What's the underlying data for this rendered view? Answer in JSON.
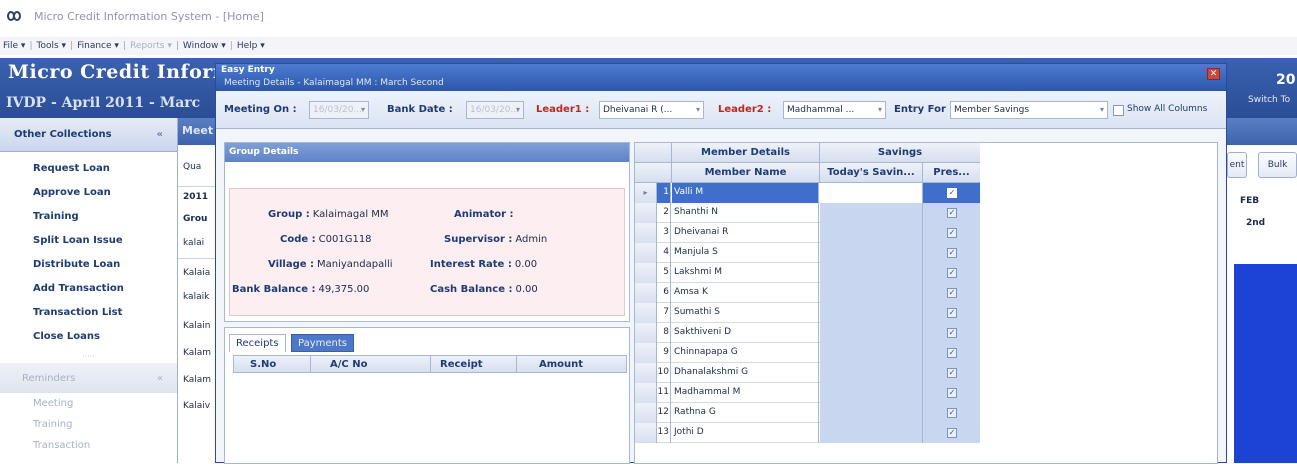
{
  "app": {
    "window_title": "Micro Credit Information System - [Home]",
    "menu": [
      {
        "label": "File ▾",
        "disabled": false
      },
      {
        "label": "Tools ▾",
        "disabled": false
      },
      {
        "label": "Finance ▾",
        "disabled": false
      },
      {
        "label": "Reports ▾",
        "disabled": true
      },
      {
        "label": "Window ▾",
        "disabled": false
      },
      {
        "label": "Help ▾",
        "disabled": false
      }
    ],
    "brand_title": "Micro Credit Informa",
    "brand_subtitle": "IVDP - April 2011 - Marc",
    "brand_year": "20",
    "switch_label": "Switch To"
  },
  "sidebar": {
    "header": "Other Collections",
    "collapse_glyph": "«",
    "links": [
      "Request Loan",
      "Approve Loan",
      "Training",
      "Split Loan Issue",
      "Distribute Loan",
      "Add Transaction",
      "Transaction List",
      "Close Loans"
    ],
    "divider": "·····",
    "section2": "Reminders",
    "section2_links": [
      "Meeting",
      "Training",
      "Transaction"
    ]
  },
  "background": {
    "strip_label": "Meet",
    "qua_label": "Qua",
    "year_cell": "2011",
    "grou_cell": "Grou",
    "rows": [
      "kalai",
      "Kalaia",
      "kalaik",
      "Kalain",
      "Kalam",
      "Kalam",
      "Kalaiv"
    ],
    "feb": "FEB",
    "second": "2nd",
    "bulk": "Bulk",
    "ent": "ent"
  },
  "dialog": {
    "title": "Easy Entry",
    "subtitle": "Meeting Details - Kalaimagal MM : March Second",
    "close_glyph": "✕",
    "filters": {
      "meeting_on_label": "Meeting On :",
      "meeting_on_value": "16/03/20...",
      "bank_date_label": "Bank Date :",
      "bank_date_value": "16/03/20...",
      "leader1_label": "Leader1 :",
      "leader1_value": "Dheivanai R (...",
      "leader2_label": "Leader2 :",
      "leader2_value": "Madhammal ...",
      "entry_for_label": "Entry For :",
      "entry_for_value": "Member Savings",
      "show_all_label": "Show All Columns",
      "dropdown_glyph": "▾"
    },
    "group": {
      "header": "Group Details",
      "group_label": "Group :",
      "group_value": "Kalaimagal MM",
      "animator_label": "Animator :",
      "animator_value": "",
      "code_label": "Code :",
      "code_value": "C001G118",
      "supervisor_label": "Supervisor :",
      "supervisor_value": "Admin",
      "village_label": "Village :",
      "village_value": "Maniyandapalli",
      "interest_label": "Interest Rate :",
      "interest_value": "0.00",
      "bank_balance_label": "Bank Balance :",
      "bank_balance_value": "49,375.00",
      "cash_balance_label": "Cash Balance :",
      "cash_balance_value": "0.00"
    },
    "tabs": {
      "receipts": "Receipts",
      "payments": "Payments",
      "columns": [
        "S.No",
        "A/C No",
        "Receipt",
        "Amount"
      ]
    },
    "members": {
      "group_header_details": "Member Details",
      "group_header_savings": "Savings",
      "col_name": "Member Name",
      "col_savings": "Today's Savin...",
      "col_present": "Pres...",
      "row_indicator": "▸",
      "check_glyph": "✓",
      "rows": [
        {
          "no": "1",
          "name": "Valli M"
        },
        {
          "no": "2",
          "name": "Shanthi N"
        },
        {
          "no": "3",
          "name": "Dheivanai R"
        },
        {
          "no": "4",
          "name": "Manjula S"
        },
        {
          "no": "5",
          "name": "Lakshmi M"
        },
        {
          "no": "6",
          "name": "Amsa K"
        },
        {
          "no": "7",
          "name": "Sumathi S"
        },
        {
          "no": "8",
          "name": "Sakthiveni D"
        },
        {
          "no": "9",
          "name": "Chinnapapa G"
        },
        {
          "no": "10",
          "name": "Dhanalakshmi G"
        },
        {
          "no": "11",
          "name": "Madhammal M"
        },
        {
          "no": "12",
          "name": "Rathna G"
        },
        {
          "no": "13",
          "name": "Jothi D"
        }
      ]
    }
  },
  "colors": {
    "brand_blue": "#2b4d95",
    "selection_blue": "#3f6fcb",
    "leader_red": "#c8241b",
    "info_pink": "#fdeff1"
  }
}
